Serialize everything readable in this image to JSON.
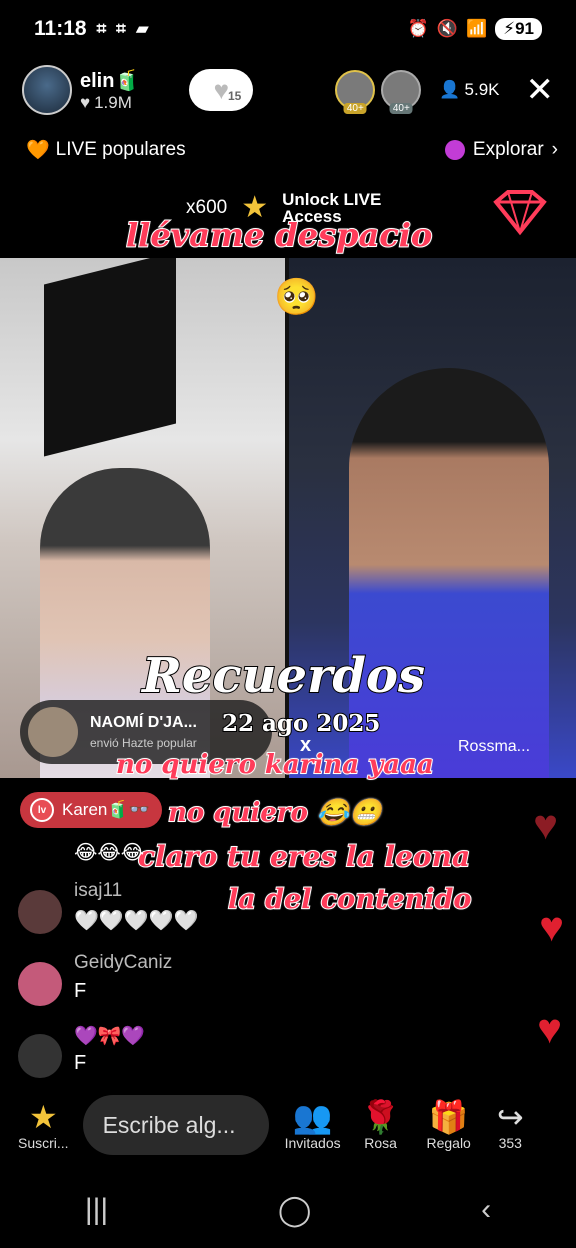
{
  "status_bar": {
    "time": "11:18",
    "battery": "91"
  },
  "host": {
    "name": "elin🧃",
    "likes": "1.9M"
  },
  "follow_pill": {
    "count": "15"
  },
  "viewers": {
    "avatars": [
      {
        "badge": "40+"
      },
      {
        "badge": "40+"
      }
    ],
    "count": "5.9K"
  },
  "sub_header": {
    "left_label": "LIVE populares",
    "right_label": "Explorar"
  },
  "promo": {
    "multiplier": "x600",
    "line1": "Unlock LIVE",
    "line2": "Access"
  },
  "overlay": {
    "song": "llévame despacio",
    "emoji": "🥺",
    "title": "Recuerdos",
    "date": "22 ago 2025",
    "lines": [
      "no quiero karina  yaaa",
      "no quiero 😂😬",
      "claro tu eres la leona",
      "la del contenido"
    ]
  },
  "gift": {
    "name": "NAOMÍ D'JA...",
    "text": "envió Hazte popular"
  },
  "right_host_name": "Rossma...",
  "vs_mark": "x",
  "badge_comment": {
    "level": "lv",
    "name": "Karen🧃👓"
  },
  "comments": [
    {
      "name": "",
      "text": "😂😂😂"
    },
    {
      "name": "isaj11",
      "text": "🤍🤍🤍🤍🤍"
    },
    {
      "name": "GeidyCaniz",
      "text": "F"
    },
    {
      "name": "💜🎀💜",
      "text": "F"
    }
  ],
  "bottom_bar": {
    "suscribe": "Suscri...",
    "input_placeholder": "Escribe alg...",
    "guests": "Invitados",
    "rose": "Rosa",
    "gift": "Regalo",
    "share_count": "353"
  },
  "colors": {
    "accent": "#ff3c5a",
    "heart": "#e02030",
    "badge": "#c7363f"
  }
}
